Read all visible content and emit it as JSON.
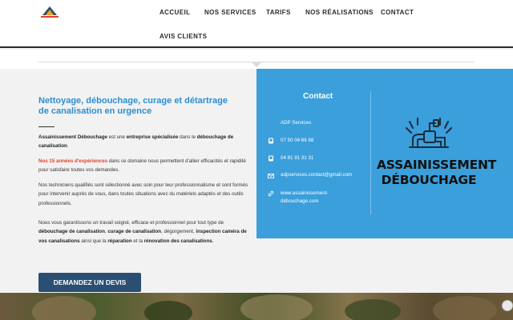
{
  "nav": {
    "items": [
      {
        "label": "ACCUEIL"
      },
      {
        "label": "NOS SERVICES"
      },
      {
        "label": "TARIFS"
      },
      {
        "label": "NOS RÉALISATIONS"
      },
      {
        "label": "CONTACT"
      },
      {
        "label": "AVIS CLIENTS"
      }
    ]
  },
  "main": {
    "title": "Nettoyage, débouchage, curage et détartrage de canalisation en urgence",
    "p1": {
      "a": "Assainissement Débouchage",
      "b": " est une ",
      "c": "entreprise spécialisée",
      "d": " dans le ",
      "e": "débouchage de canalisation",
      "f": "."
    },
    "p2": {
      "a": "Nos 15 années d'expériences",
      "b": " dans ce domaine nous permettent d'allier efficacités et rapidité pour satisfaire toutes vos demandes."
    },
    "p3": "Nos techniciens qualifiés sont sélectionné avec soin pour leur professionnalisme et sont formés pour intervenir auprès de vous, dans toutes situations avec du matériels adaptés et des outils professionnels.",
    "p4": {
      "a": "Nous vous garantissons un travail soigné, efficace et professionnel pour tout type de ",
      "b": "débouchage de canalisation",
      "c": ", ",
      "d": "curage de canalisation",
      "e": ", dégorgement, ",
      "f": "inspection caméra de vos canalisations",
      "g": " ainsi que la ",
      "h": "réparation",
      "i": " et la ",
      "j": "rénovation des canalisations",
      "k": "."
    },
    "cta_label": "DEMANDEZ UN DEVIS"
  },
  "contact": {
    "title": "Contact",
    "company": "ADP Services",
    "phone1": "07 50 04 66 88",
    "phone2": "04 81 91 31 31",
    "email": "adpservices.contact@gmail.com",
    "website_line1": "www.assainissement-",
    "website_line2": "débouchage.com"
  },
  "brand": {
    "line1": "ASSAINISSEMENT",
    "line2": "DÉBOUCHAGE"
  },
  "colors": {
    "accent_blue": "#3a9fdb",
    "title_blue": "#2b8fd1",
    "cta": "#2a4f73",
    "highlight_red": "#e0402a"
  }
}
